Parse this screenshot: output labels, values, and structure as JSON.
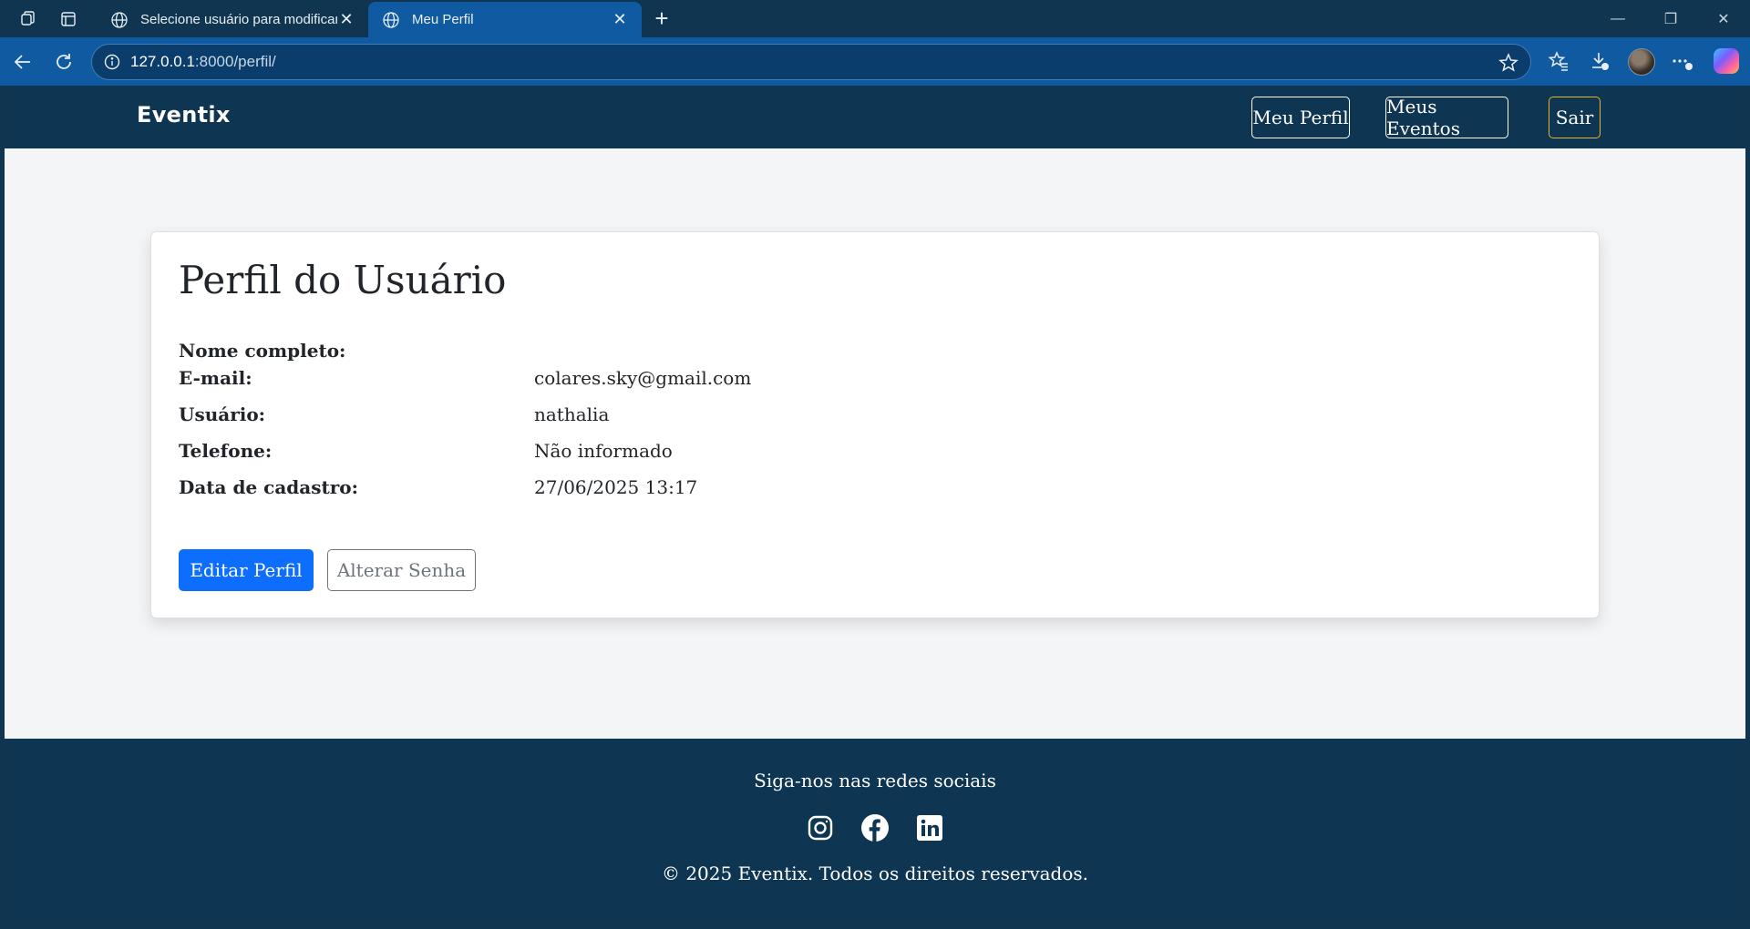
{
  "browser": {
    "tabs": [
      {
        "title": "Selecione usuário para modificar | ",
        "active": false
      },
      {
        "title": "Meu Perfil",
        "active": true
      }
    ],
    "url_host": "127.0.0.1",
    "url_path": ":8000/perfil/",
    "icons": [
      "workspaces-icon",
      "tab-actions-icon",
      "globe-icon",
      "close-icon",
      "new-tab-icon",
      "back-icon",
      "refresh-icon",
      "info-icon",
      "star-icon",
      "favorites-icon",
      "downloads-icon",
      "avatar",
      "more-icon",
      "copilot-icon",
      "minimize-icon",
      "restore-icon",
      "window-close-icon"
    ]
  },
  "nav": {
    "brand": "Eventix",
    "buttons": [
      "Meu Perfil",
      "Meus Eventos",
      "Sair"
    ]
  },
  "profile": {
    "title": "Perfil do Usuário",
    "fields": [
      {
        "label": "Nome completo:",
        "value": ""
      },
      {
        "label": "E-mail:",
        "value": "colares.sky@gmail.com"
      },
      {
        "label": "Usuário:",
        "value": "nathalia"
      },
      {
        "label": "Telefone:",
        "value": "Não informado"
      },
      {
        "label": "Data de cadastro:",
        "value": "27/06/2025 13:17"
      }
    ],
    "edit_button": "Editar Perfil",
    "password_button": "Alterar Senha"
  },
  "footer": {
    "follow_text": "Siga-nos nas redes sociais",
    "social_icons": [
      "instagram-icon",
      "facebook-icon",
      "linkedin-icon"
    ],
    "copyright": "© 2025 Eventix. Todos os direitos reservados."
  },
  "colors": {
    "navbar": "#0e3652",
    "primary": "#0d6efd",
    "sair_border": "#e1b52d",
    "browser_active_tab": "#0f5aa0"
  }
}
